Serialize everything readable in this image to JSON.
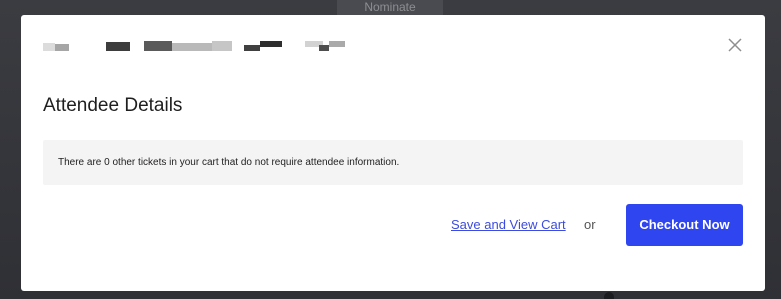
{
  "background": {
    "tab_label": "Nominate"
  },
  "modal": {
    "title": "Attendee Details",
    "notice": "There are 0 other tickets in your cart that do not require attendee information.",
    "actions": {
      "save_link": "Save and View Cart",
      "separator": "or",
      "checkout_button": "Checkout Now"
    },
    "close_icon": "close-icon",
    "colors": {
      "accent": "#2f45f0",
      "link": "#3d4cdb",
      "notice_bg": "#f5f4f4"
    }
  }
}
